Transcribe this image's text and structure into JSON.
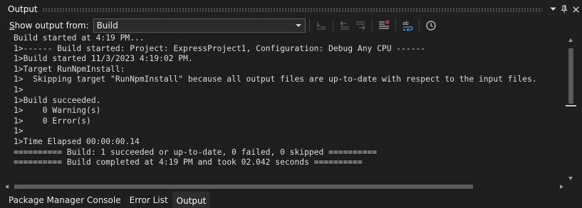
{
  "window": {
    "title": "Output",
    "buttons": {
      "dropdown_icon": "chevron-down-icon",
      "pin_icon": "pin-icon",
      "close_icon": "close-icon"
    }
  },
  "toolbar": {
    "show_output_label_prefix": "S",
    "show_output_label_rest": "how output from:",
    "source_value": "Build",
    "icons": [
      "go-to-line-icon",
      "previous-message-icon",
      "next-message-icon",
      "clear-all-icon",
      "toggle-word-wrap-icon",
      "toggle-timestamp-icon"
    ]
  },
  "output": {
    "lines": [
      "Build started at 4:19 PM...",
      "1>------ Build started: Project: ExpressProject1, Configuration: Debug Any CPU ------",
      "1>Build started 11/3/2023 4:19:02 PM.",
      "1>Target RunNpmInstall:",
      "1>  Skipping target \"RunNpmInstall\" because all output files are up-to-date with respect to the input files.",
      "1>",
      "1>Build succeeded.",
      "1>    0 Warning(s)",
      "1>    0 Error(s)",
      "1>",
      "1>Time Elapsed 00:00:00.14",
      "========== Build: 1 succeeded or up-to-date, 0 failed, 0 skipped ==========",
      "========== Build completed at 4:19 PM and took 02.042 seconds =========="
    ]
  },
  "tabs": [
    {
      "label": "Package Manager Console",
      "active": false
    },
    {
      "label": "Error List",
      "active": false
    },
    {
      "label": "Output",
      "active": true
    }
  ],
  "colors": {
    "background": "#1f1f1f",
    "output_bg": "#1e1e1e",
    "text": "#dcdcdc",
    "clear_icon_red": "#e04a4a",
    "wrap_icon_blue": "#3c9be0"
  }
}
